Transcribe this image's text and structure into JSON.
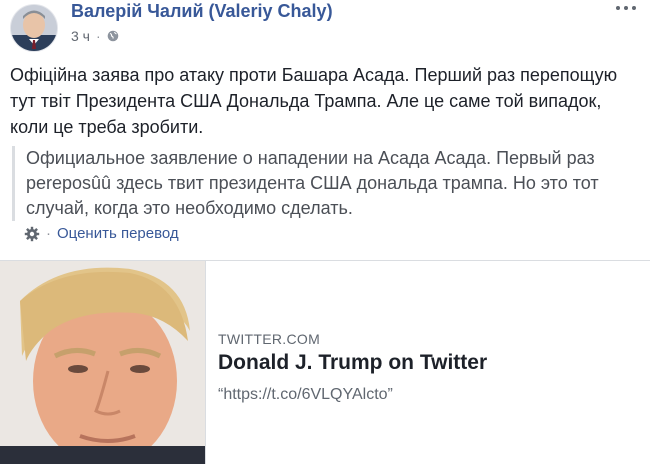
{
  "post": {
    "author": "Валерій Чалий (Valeriy Chaly)",
    "time": "3 ч",
    "privacy_icon": "globe-icon",
    "more_icon": "more-options-icon",
    "text": "Офіційна заява про атаку проти Башара Асада. Перший раз перепощую тут твіт Президента США Дональда Трампа. Але це саме той випадок, коли це треба зробити."
  },
  "translation": {
    "text": "Официальное заявление о нападении на Асада Асада. Первый раз pereposûû здесь твит президента США дональда трампа. Но это тот случай, когда это необходимо сделать.",
    "gear_icon": "gear-icon",
    "separator": "·",
    "rate_label": "Оценить перевод"
  },
  "link_card": {
    "domain": "TWITTER.COM",
    "title": "Donald J. Trump on Twitter",
    "description": "“https://t.co/6VLQYAlcto”"
  },
  "colors": {
    "link_blue": "#385898",
    "text": "#1d2129",
    "muted": "#606770",
    "border": "#dadde1"
  }
}
